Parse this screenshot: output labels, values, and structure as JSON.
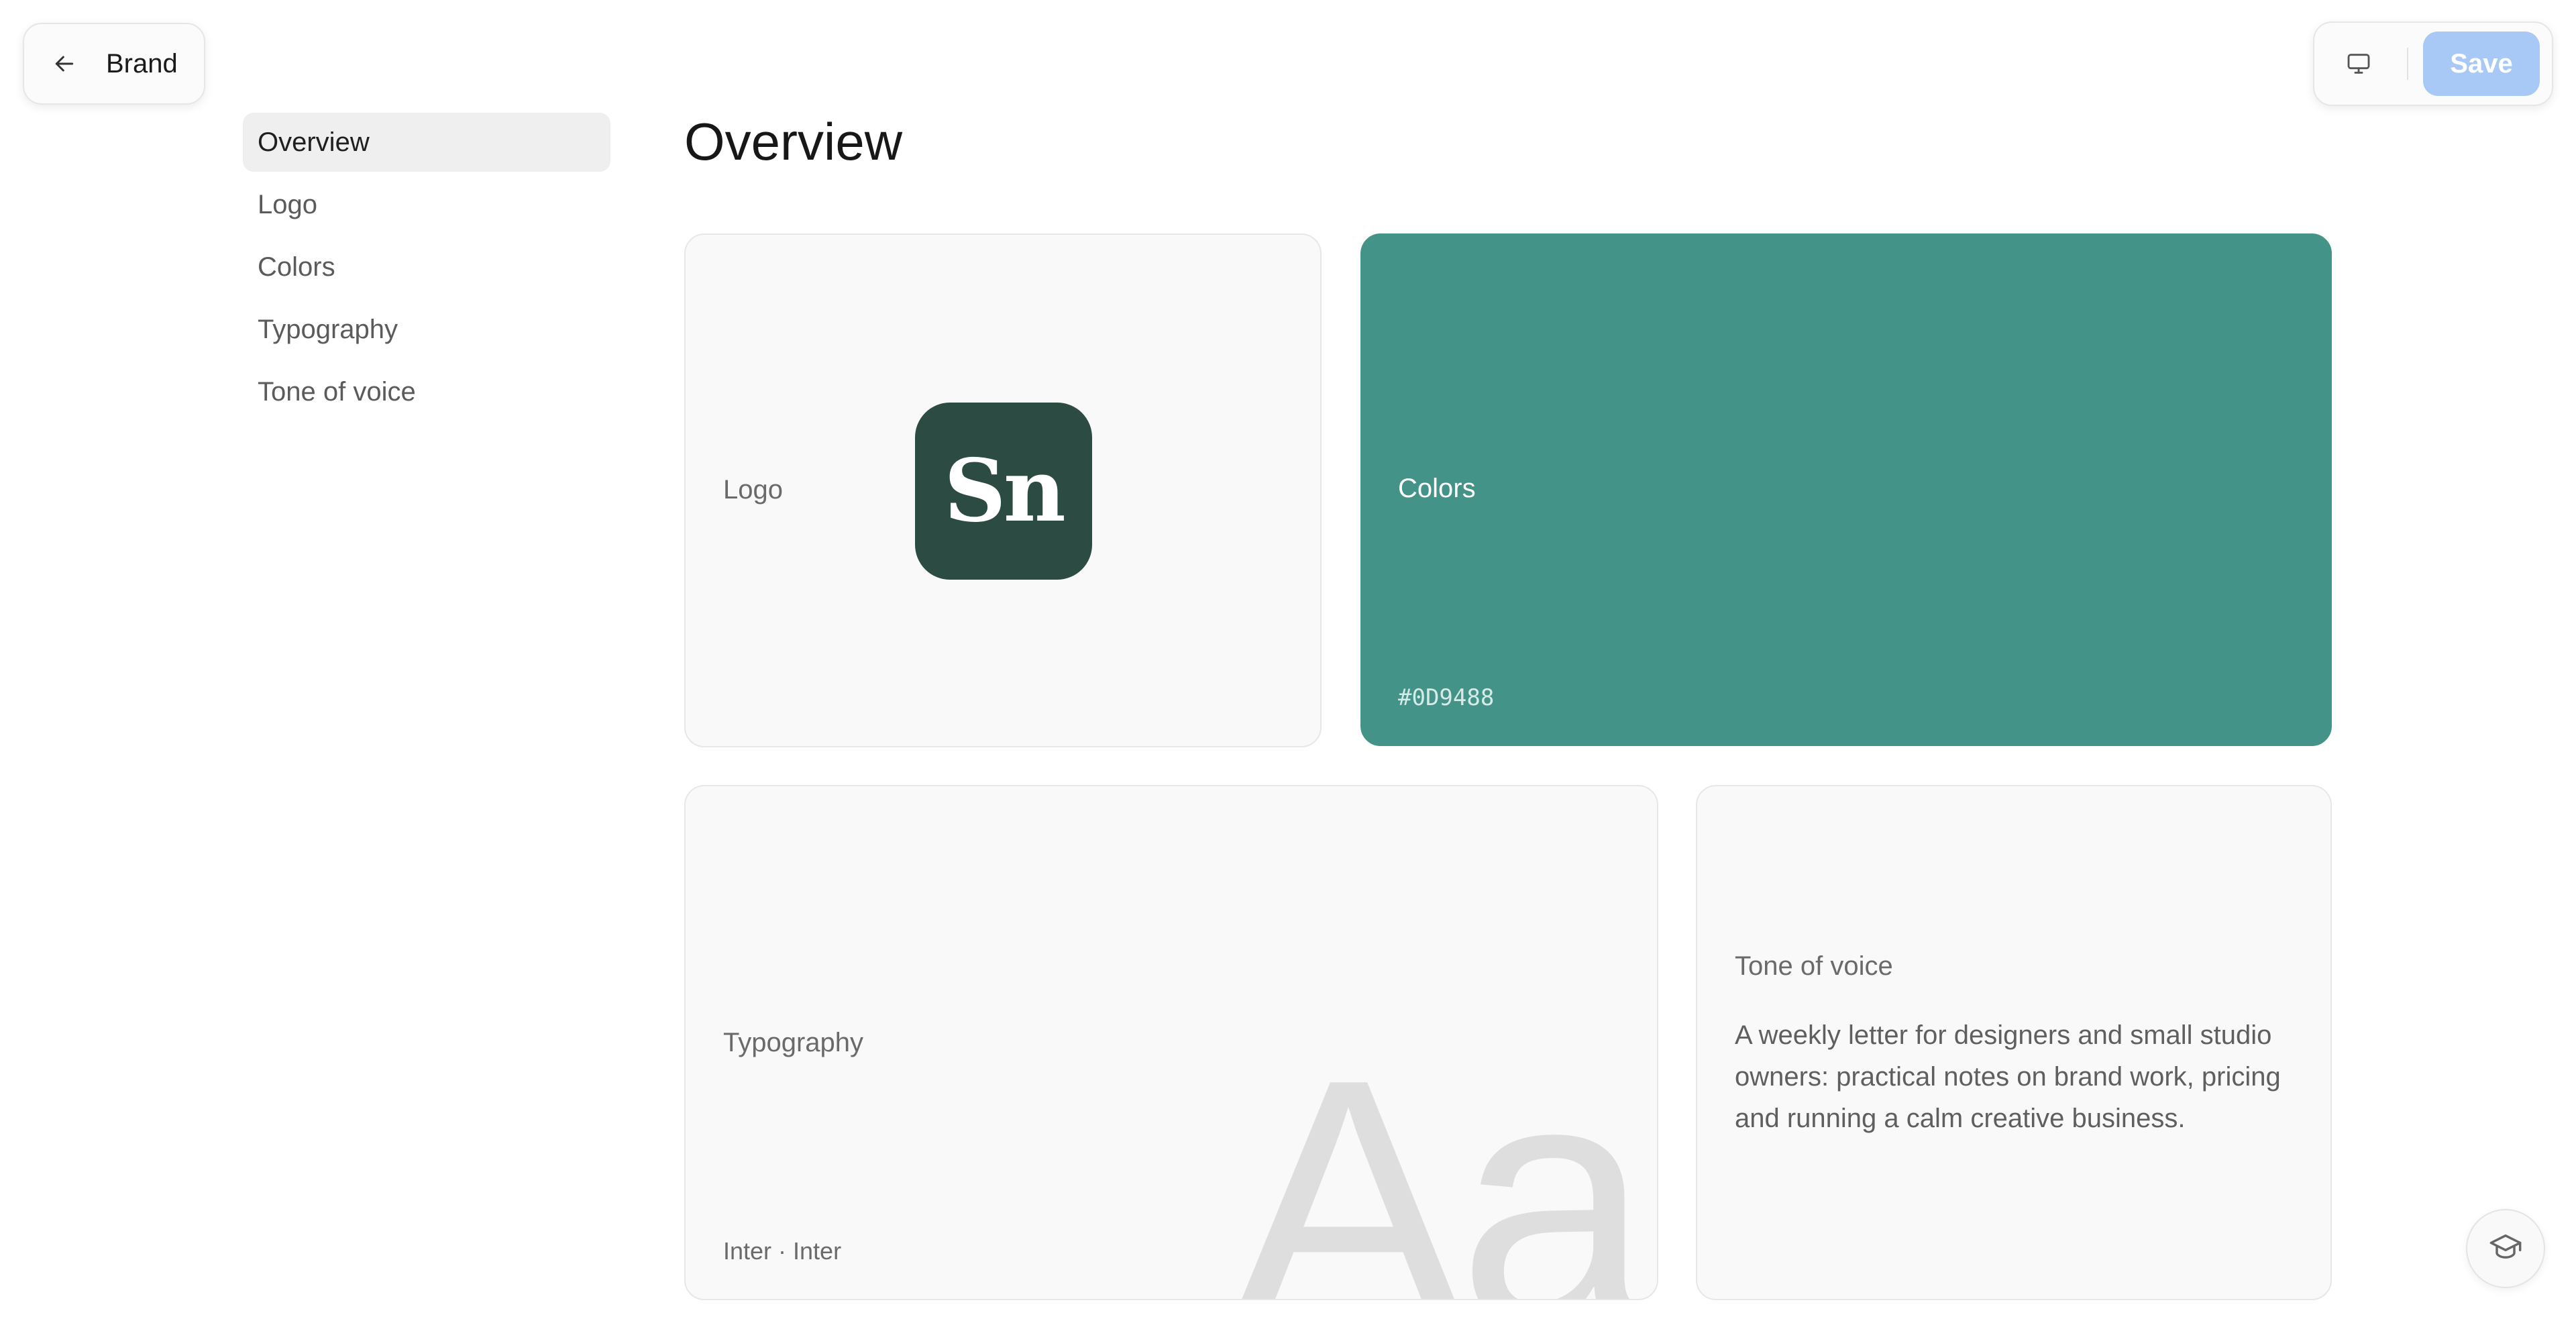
{
  "header": {
    "back_label": "Brand",
    "back_icon": "arrow-left-icon",
    "preview_icon": "monitor-icon",
    "save_label": "Save"
  },
  "sidebar": {
    "items": [
      {
        "label": "Overview",
        "active": true
      },
      {
        "label": "Logo",
        "active": false
      },
      {
        "label": "Colors",
        "active": false
      },
      {
        "label": "Typography",
        "active": false
      },
      {
        "label": "Tone of voice",
        "active": false
      }
    ]
  },
  "main": {
    "title": "Overview",
    "logo_card": {
      "label": "Logo",
      "mark_text": "Sn"
    },
    "colors_card": {
      "label": "Colors",
      "hex": "#0D9488",
      "swatch_color": "#439388"
    },
    "typography_card": {
      "label": "Typography",
      "fonts": "Inter · Inter",
      "specimen": "Aa"
    },
    "tone_card": {
      "label": "Tone of voice",
      "description": "A weekly letter for designers and small studio owners: practical notes on brand work, pricing and running a calm creative business."
    }
  },
  "help": {
    "icon": "graduation-cap-icon"
  },
  "colors": {
    "save_button": "#a8c9f5",
    "logo_mark": "#2c4b43",
    "brand_swatch": "#439388"
  }
}
